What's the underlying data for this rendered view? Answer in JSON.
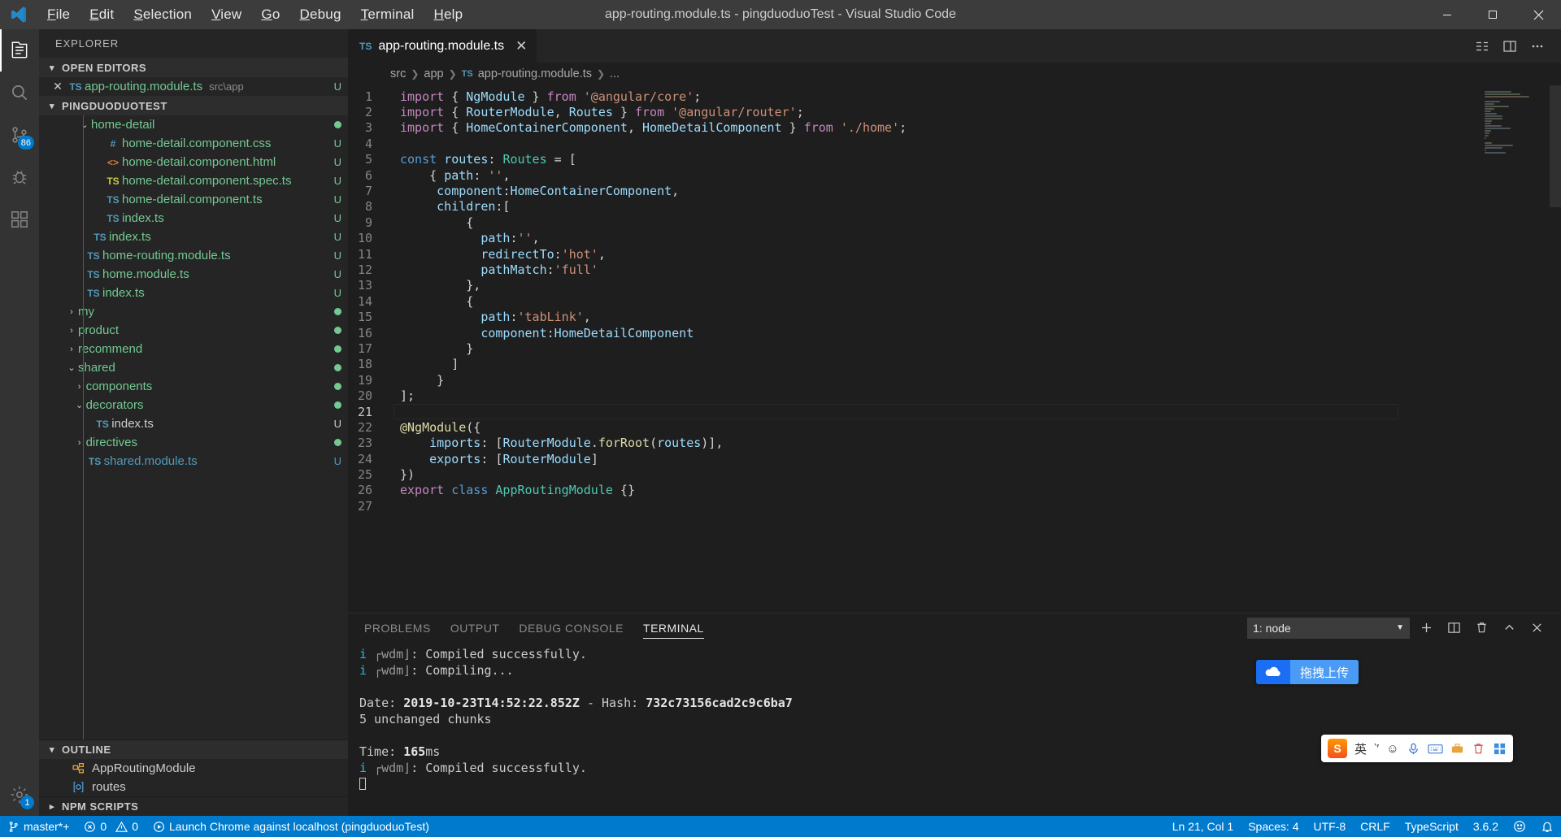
{
  "titlebar": {
    "window_title": "app-routing.module.ts - pingduoduoTest - Visual Studio Code",
    "menus": [
      {
        "label": "File",
        "mnemonic": "F"
      },
      {
        "label": "Edit",
        "mnemonic": "E"
      },
      {
        "label": "Selection",
        "mnemonic": "S"
      },
      {
        "label": "View",
        "mnemonic": "V"
      },
      {
        "label": "Go",
        "mnemonic": "G"
      },
      {
        "label": "Debug",
        "mnemonic": "D"
      },
      {
        "label": "Terminal",
        "mnemonic": "T"
      },
      {
        "label": "Help",
        "mnemonic": "H"
      }
    ],
    "controls": [
      "minimize",
      "maximize",
      "close"
    ]
  },
  "activitybar": {
    "items": [
      {
        "name": "explorer",
        "active": true
      },
      {
        "name": "search",
        "active": false
      },
      {
        "name": "source-control",
        "active": false,
        "badge": "86"
      },
      {
        "name": "debug",
        "active": false
      },
      {
        "name": "extensions",
        "active": false
      }
    ],
    "bottom": [
      {
        "name": "settings",
        "badge": "1"
      }
    ]
  },
  "sidebar": {
    "title": "EXPLORER",
    "open_editors": {
      "label": "OPEN EDITORS",
      "items": [
        {
          "name": "app-routing.module.ts",
          "path": "src\\app",
          "icon": "ts",
          "status": "U"
        }
      ]
    },
    "project": {
      "label": "PINGDUODUOTEST",
      "items": [
        {
          "label": "home-detail",
          "indent": 3,
          "twisty": "open",
          "icon": "folder",
          "status": "dot",
          "color": "green"
        },
        {
          "label": "home-detail.component.css",
          "indent": 4,
          "twisty": "",
          "icon": "css",
          "status": "U",
          "color": "green"
        },
        {
          "label": "home-detail.component.html",
          "indent": 4,
          "twisty": "",
          "icon": "html",
          "status": "U",
          "color": "green"
        },
        {
          "label": "home-detail.component.spec.ts",
          "indent": 4,
          "twisty": "",
          "icon": "spec",
          "status": "U",
          "color": "green"
        },
        {
          "label": "home-detail.component.ts",
          "indent": 4,
          "twisty": "",
          "icon": "ts",
          "status": "U",
          "color": "green"
        },
        {
          "label": "index.ts",
          "indent": 4,
          "twisty": "",
          "icon": "ts",
          "status": "U",
          "color": "green"
        },
        {
          "label": "index.ts",
          "indent": 3,
          "twisty": "",
          "icon": "ts",
          "status": "U",
          "color": "green"
        },
        {
          "label": "home-routing.module.ts",
          "indent": 2.5,
          "twisty": "",
          "icon": "ts",
          "status": "U",
          "color": "green"
        },
        {
          "label": "home.module.ts",
          "indent": 2.5,
          "twisty": "",
          "icon": "ts",
          "status": "U",
          "color": "green"
        },
        {
          "label": "index.ts",
          "indent": 2.5,
          "twisty": "",
          "icon": "ts",
          "status": "U",
          "color": "green"
        },
        {
          "label": "my",
          "indent": 2,
          "twisty": "closed",
          "icon": "folder",
          "status": "dot",
          "color": "green"
        },
        {
          "label": "product",
          "indent": 2,
          "twisty": "closed",
          "icon": "folder",
          "status": "dot",
          "color": "green"
        },
        {
          "label": "recommend",
          "indent": 2,
          "twisty": "closed",
          "icon": "folder",
          "status": "dot",
          "color": "green"
        },
        {
          "label": "shared",
          "indent": 2,
          "twisty": "open",
          "icon": "folder",
          "status": "dot",
          "color": "green"
        },
        {
          "label": "components",
          "indent": 2.6,
          "twisty": "closed",
          "icon": "folder",
          "status": "dot",
          "color": "green"
        },
        {
          "label": "decorators",
          "indent": 2.6,
          "twisty": "open",
          "icon": "folder",
          "status": "dot",
          "color": "green"
        },
        {
          "label": "index.ts",
          "indent": 3.2,
          "twisty": "",
          "icon": "ts",
          "status": "U",
          "color": "white"
        },
        {
          "label": "directives",
          "indent": 2.6,
          "twisty": "closed",
          "icon": "folder",
          "status": "dot",
          "color": "green"
        },
        {
          "label": "shared.module.ts",
          "indent": 2.6,
          "twisty": "",
          "icon": "ts",
          "status": "U",
          "color": "blue"
        }
      ]
    },
    "outline": {
      "label": "OUTLINE",
      "items": [
        {
          "label": "AppRoutingModule",
          "icon": "class-icon"
        },
        {
          "label": "routes",
          "icon": "variable-icon"
        }
      ]
    },
    "npm_scripts": {
      "label": "NPM SCRIPTS"
    }
  },
  "editor": {
    "tab": {
      "label": "app-routing.module.ts",
      "icon": "ts",
      "dirty": false
    },
    "tab_actions": [
      "split-editor-icon",
      "layout-icon",
      "more-actions-icon"
    ],
    "breadcrumb": [
      "src",
      "app",
      "app-routing.module.ts",
      "..."
    ],
    "lines": [
      {
        "n": 1,
        "status": "U",
        "tokens": [
          [
            "kw",
            "import"
          ],
          [
            "pun",
            " { "
          ],
          [
            "id",
            "NgModule"
          ],
          [
            "pun",
            " } "
          ],
          [
            "kw",
            "from"
          ],
          [
            "pun",
            " "
          ],
          [
            "str",
            "'@angular/core'"
          ],
          [
            "pun",
            ";"
          ]
        ]
      },
      {
        "n": 2,
        "status": "U",
        "tokens": [
          [
            "kw",
            "import"
          ],
          [
            "pun",
            " { "
          ],
          [
            "id",
            "RouterModule"
          ],
          [
            "pun",
            ", "
          ],
          [
            "id",
            "Routes"
          ],
          [
            "pun",
            " } "
          ],
          [
            "kw",
            "from"
          ],
          [
            "pun",
            " "
          ],
          [
            "str",
            "'@angular/router'"
          ],
          [
            "pun",
            ";"
          ]
        ]
      },
      {
        "n": 3,
        "status": "dot",
        "tokens": [
          [
            "kw",
            "import"
          ],
          [
            "pun",
            " { "
          ],
          [
            "id",
            "HomeContainerComponent"
          ],
          [
            "pun",
            ", "
          ],
          [
            "id",
            "HomeDetailComponent"
          ],
          [
            "pun",
            " } "
          ],
          [
            "kw",
            "from"
          ],
          [
            "pun",
            " "
          ],
          [
            "str",
            "'./home'"
          ],
          [
            "pun",
            ";"
          ]
        ]
      },
      {
        "n": 4,
        "status": "U",
        "tokens": []
      },
      {
        "n": 5,
        "status": "U",
        "tokens": [
          [
            "kw2",
            "const"
          ],
          [
            "pun",
            " "
          ],
          [
            "id",
            "routes"
          ],
          [
            "pun",
            ": "
          ],
          [
            "typ",
            "Routes"
          ],
          [
            "pun",
            " = ["
          ]
        ]
      },
      {
        "n": 6,
        "status": "U",
        "tokens": [
          [
            "pun",
            "    { "
          ],
          [
            "id",
            "path"
          ],
          [
            "pun",
            ": "
          ],
          [
            "str",
            "''"
          ],
          [
            "pun",
            ","
          ]
        ]
      },
      {
        "n": 7,
        "status": "U",
        "tokens": [
          [
            "pun",
            "     "
          ],
          [
            "id",
            "component"
          ],
          [
            "pun",
            ":"
          ],
          [
            "id",
            "HomeContainerComponent"
          ],
          [
            "pun",
            ","
          ]
        ]
      },
      {
        "n": 8,
        "status": "U",
        "tokens": [
          [
            "pun",
            "     "
          ],
          [
            "id",
            "children"
          ],
          [
            "pun",
            ":["
          ]
        ]
      },
      {
        "n": 9,
        "status": "U",
        "tokens": [
          [
            "pun",
            "         {"
          ]
        ]
      },
      {
        "n": 10,
        "status": "U",
        "tokens": [
          [
            "pun",
            "           "
          ],
          [
            "id",
            "path"
          ],
          [
            "pun",
            ":"
          ],
          [
            "str",
            "''"
          ],
          [
            "pun",
            ","
          ]
        ]
      },
      {
        "n": 11,
        "status": "U",
        "tokens": [
          [
            "pun",
            "           "
          ],
          [
            "id",
            "redirectTo"
          ],
          [
            "pun",
            ":"
          ],
          [
            "str",
            "'hot'"
          ],
          [
            "pun",
            ","
          ]
        ]
      },
      {
        "n": 12,
        "status": "U",
        "tokens": [
          [
            "pun",
            "           "
          ],
          [
            "id",
            "pathMatch"
          ],
          [
            "pun",
            ":"
          ],
          [
            "str",
            "'full'"
          ]
        ]
      },
      {
        "n": 13,
        "status": "U",
        "tokens": [
          [
            "pun",
            "         },"
          ]
        ]
      },
      {
        "n": 14,
        "status": "U",
        "tokens": [
          [
            "pun",
            "         {"
          ]
        ]
      },
      {
        "n": 15,
        "status": "dot",
        "tokens": [
          [
            "pun",
            "           "
          ],
          [
            "id",
            "path"
          ],
          [
            "pun",
            ":"
          ],
          [
            "str",
            "'tabLink'"
          ],
          [
            "pun",
            ","
          ]
        ]
      },
      {
        "n": 16,
        "status": "dot",
        "tokens": [
          [
            "pun",
            "           "
          ],
          [
            "id",
            "component"
          ],
          [
            "pun",
            ":"
          ],
          [
            "id",
            "HomeDetailComponent"
          ]
        ]
      },
      {
        "n": 17,
        "status": "dot",
        "tokens": [
          [
            "pun",
            "         }"
          ]
        ]
      },
      {
        "n": 18,
        "status": "dot",
        "tokens": [
          [
            "pun",
            "       ]"
          ]
        ]
      },
      {
        "n": 19,
        "status": "dot",
        "tokens": [
          [
            "pun",
            "     }"
          ]
        ]
      },
      {
        "n": 20,
        "status": "dot",
        "tokens": [
          [
            "pun",
            "];"
          ]
        ]
      },
      {
        "n": 21,
        "status": "U",
        "tokens": [],
        "current": true
      },
      {
        "n": 22,
        "status": "",
        "tokens": [
          [
            "dec",
            "@NgModule"
          ],
          [
            "pun",
            "({"
          ]
        ]
      },
      {
        "n": 23,
        "status": "dot",
        "tokens": [
          [
            "pun",
            "    "
          ],
          [
            "id",
            "imports"
          ],
          [
            "pun",
            ": ["
          ],
          [
            "id",
            "RouterModule"
          ],
          [
            "pun",
            "."
          ],
          [
            "fn",
            "forRoot"
          ],
          [
            "pun",
            "("
          ],
          [
            "id",
            "routes"
          ],
          [
            "pun",
            ")],"
          ]
        ]
      },
      {
        "n": 24,
        "status": "",
        "tokens": [
          [
            "pun",
            "    "
          ],
          [
            "id",
            "exports"
          ],
          [
            "pun",
            ": ["
          ],
          [
            "id",
            "RouterModule"
          ],
          [
            "pun",
            "]"
          ]
        ]
      },
      {
        "n": 25,
        "status": "",
        "tokens": [
          [
            "pun",
            "})"
          ]
        ]
      },
      {
        "n": 26,
        "status": "",
        "tokens": [
          [
            "kw",
            "export"
          ],
          [
            "pun",
            " "
          ],
          [
            "kw2",
            "class"
          ],
          [
            "pun",
            " "
          ],
          [
            "typ",
            "AppRoutingModule"
          ],
          [
            "pun",
            " {}"
          ]
        ]
      },
      {
        "n": 27,
        "status": "",
        "tokens": []
      }
    ]
  },
  "panel": {
    "tabs": [
      {
        "label": "PROBLEMS",
        "active": false
      },
      {
        "label": "OUTPUT",
        "active": false
      },
      {
        "label": "DEBUG CONSOLE",
        "active": false
      },
      {
        "label": "TERMINAL",
        "active": true
      }
    ],
    "terminal_select": "1: node",
    "actions": [
      "add-terminal-icon",
      "split-terminal-icon",
      "kill-terminal-icon",
      "maximize-panel-icon",
      "close-panel-icon"
    ],
    "terminal_lines": [
      {
        "segments": [
          [
            "cyan",
            "i"
          ],
          [
            "gray",
            " ┌wdm⌋"
          ],
          [
            "plain",
            ": Compiled successfully."
          ]
        ]
      },
      {
        "segments": [
          [
            "cyan",
            "i"
          ],
          [
            "gray",
            " ┌wdm⌋"
          ],
          [
            "plain",
            ": Compiling..."
          ]
        ]
      },
      {
        "segments": [
          [
            "plain",
            ""
          ]
        ]
      },
      {
        "segments": [
          [
            "plain",
            "Date: "
          ],
          [
            "bold",
            "2019-10-23T14:52:22.852Z"
          ],
          [
            "plain",
            " - Hash: "
          ],
          [
            "bold",
            "732c73156cad2c9c6ba7"
          ]
        ]
      },
      {
        "segments": [
          [
            "plain",
            "5 unchanged chunks"
          ]
        ]
      },
      {
        "segments": [
          [
            "plain",
            ""
          ]
        ]
      },
      {
        "segments": [
          [
            "plain",
            "Time: "
          ],
          [
            "bold",
            "165"
          ],
          [
            "plain",
            "ms"
          ]
        ]
      },
      {
        "segments": [
          [
            "cyan",
            "i"
          ],
          [
            "gray",
            " ┌wdm⌋"
          ],
          [
            "plain",
            ": Compiled successfully."
          ]
        ]
      },
      {
        "segments": [
          [
            "cursor",
            ""
          ]
        ]
      }
    ]
  },
  "overlays": {
    "upload_widget": {
      "label": "拖拽上传",
      "icon": "cloud-upload-icon"
    },
    "ime_bar": {
      "logo": "S",
      "items": [
        "英",
        "‵′",
        "☺",
        "mic-icon",
        "keyboard-icon",
        "toolbox-icon",
        "trash-icon",
        "grid-icon"
      ]
    }
  },
  "statusbar": {
    "left": [
      {
        "name": "branch",
        "icon": "source-control-icon",
        "label": "master*+"
      },
      {
        "name": "problems",
        "icon": "error-icon",
        "label": "0",
        "icon2": "warning-icon",
        "label2": "0"
      },
      {
        "name": "launch",
        "icon": "play-icon",
        "label": "Launch Chrome against localhost (pingduoduoTest)"
      }
    ],
    "right": [
      {
        "name": "cursor-position",
        "label": "Ln 21, Col 1"
      },
      {
        "name": "indentation",
        "label": "Spaces: 4"
      },
      {
        "name": "encoding",
        "label": "UTF-8"
      },
      {
        "name": "eol",
        "label": "CRLF"
      },
      {
        "name": "language-mode",
        "label": "TypeScript"
      },
      {
        "name": "typescript-version",
        "label": "3.6.2"
      },
      {
        "name": "feedback",
        "label": "smiley-icon"
      },
      {
        "name": "notifications",
        "label": "bell-icon"
      }
    ]
  }
}
